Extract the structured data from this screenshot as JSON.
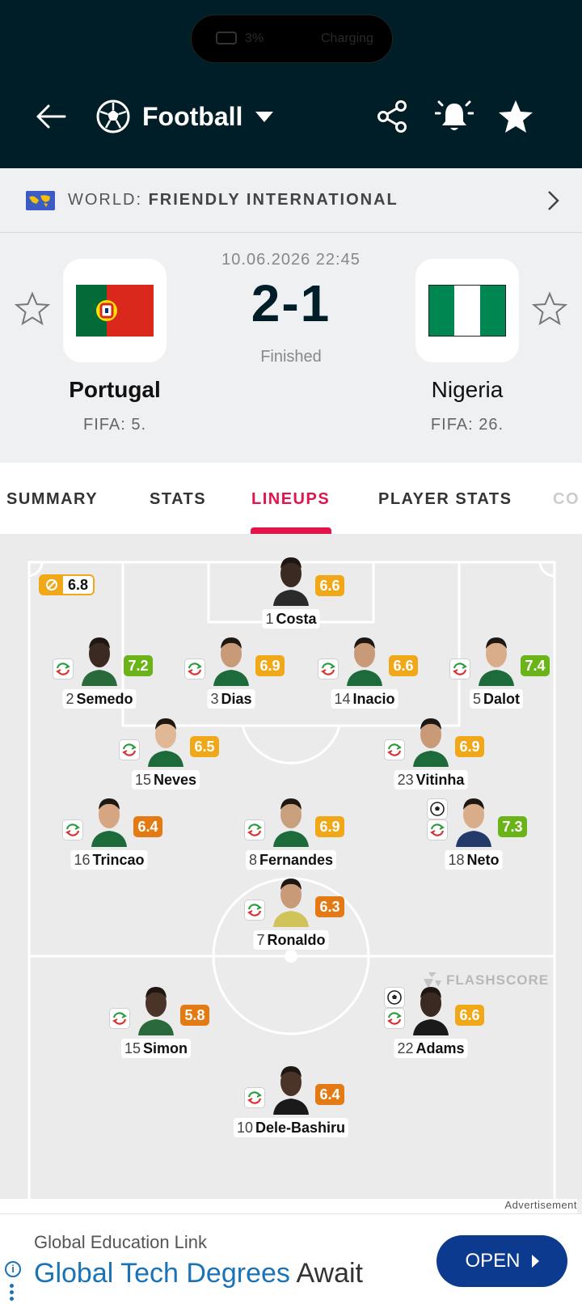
{
  "status_bar": {
    "battery": "3%",
    "charging": "Charging"
  },
  "header": {
    "sport": "Football"
  },
  "competition": {
    "region": "WORLD:",
    "name": "FRIENDLY INTERNATIONAL"
  },
  "match": {
    "datetime": "10.06.2026 22:45",
    "score": "2-1",
    "status": "Finished",
    "home": {
      "name": "Portugal",
      "fifa": "FIFA: 5."
    },
    "away": {
      "name": "Nigeria",
      "fifa": "FIFA: 26."
    }
  },
  "tabs": [
    {
      "label": "SUMMARY",
      "active": false
    },
    {
      "label": "STATS",
      "active": false
    },
    {
      "label": "LINEUPS",
      "active": true
    },
    {
      "label": "PLAYER STATS",
      "active": false
    },
    {
      "label": "CO",
      "active": false
    }
  ],
  "lineup": {
    "team_rating": "6.8",
    "watermark": "FLASHSCORE",
    "players": [
      {
        "number": "1",
        "name": "Costa",
        "rating": "6.6",
        "sub": false,
        "goal": false
      },
      {
        "number": "2",
        "name": "Semedo",
        "rating": "7.2",
        "sub": true,
        "goal": false
      },
      {
        "number": "3",
        "name": "Dias",
        "rating": "6.9",
        "sub": true,
        "goal": false
      },
      {
        "number": "14",
        "name": "Inacio",
        "rating": "6.6",
        "sub": true,
        "goal": false
      },
      {
        "number": "5",
        "name": "Dalot",
        "rating": "7.4",
        "sub": true,
        "goal": false
      },
      {
        "number": "15",
        "name": "Neves",
        "rating": "6.5",
        "sub": true,
        "goal": false
      },
      {
        "number": "23",
        "name": "Vitinha",
        "rating": "6.9",
        "sub": true,
        "goal": false
      },
      {
        "number": "16",
        "name": "Trincao",
        "rating": "6.4",
        "sub": true,
        "goal": false
      },
      {
        "number": "8",
        "name": "Fernandes",
        "rating": "6.9",
        "sub": true,
        "goal": false
      },
      {
        "number": "18",
        "name": "Neto",
        "rating": "7.3",
        "sub": true,
        "goal": true
      },
      {
        "number": "7",
        "name": "Ronaldo",
        "rating": "6.3",
        "sub": true,
        "goal": false
      },
      {
        "number": "15",
        "name": "Simon",
        "rating": "5.8",
        "sub": true,
        "goal": false
      },
      {
        "number": "22",
        "name": "Adams",
        "rating": "6.6",
        "sub": true,
        "goal": true
      },
      {
        "number": "10",
        "name": "Dele-Bashiru",
        "rating": "6.4",
        "sub": true,
        "goal": false
      }
    ]
  },
  "ad": {
    "label": "Advertisement",
    "advertiser": "Global Education Link",
    "headline_link": "Global Tech Degrees",
    "headline_rest": " Await",
    "cta": "OPEN"
  },
  "colors": {
    "header_bg": "#001e28",
    "accent": "#e3144c",
    "rating_green": "#6ab319",
    "rating_orange": "#f0a818",
    "rating_dark_orange": "#e37a14",
    "ad_button": "#0b3a8f"
  }
}
